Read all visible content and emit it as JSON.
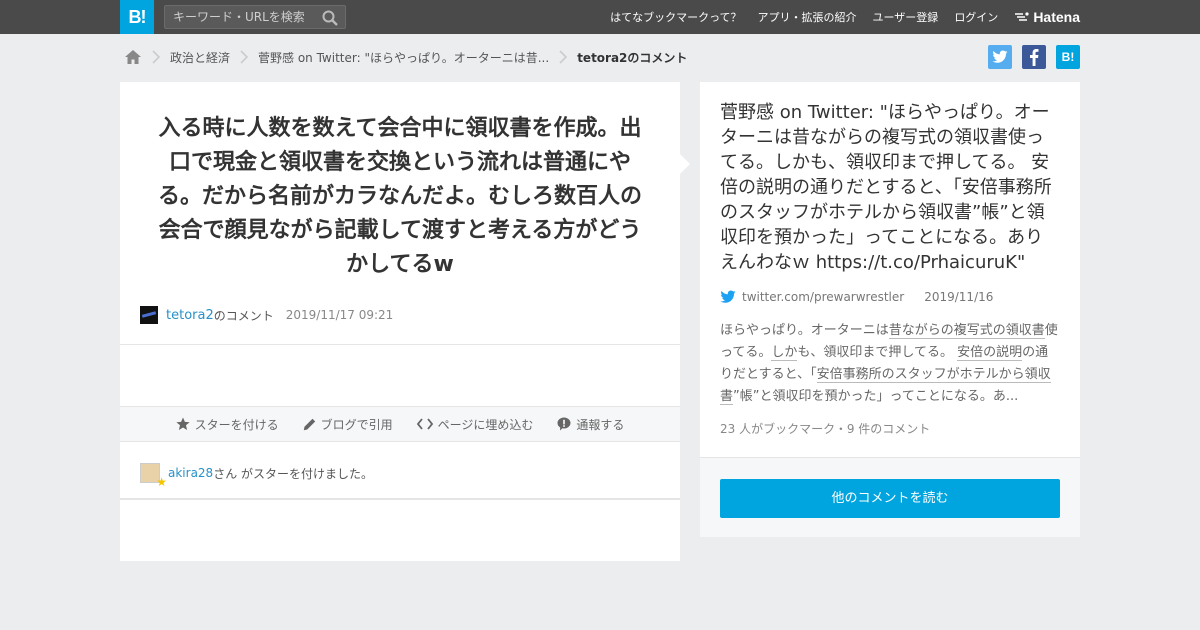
{
  "header": {
    "logo": "B!",
    "search_placeholder": "キーワード・URLを検索",
    "nav": [
      "はてなブックマークって？",
      "アプリ・拡張の紹介",
      "ユーザー登録",
      "ログイン"
    ],
    "brand": "Hatena"
  },
  "breadcrumb": {
    "items": [
      "政治と経済",
      "菅野感 on Twitter: \"ほらやっぱり。オーターニは昔...",
      "tetora2のコメント"
    ]
  },
  "share": {
    "hatena_label": "B!"
  },
  "comment": {
    "text": "入る時に人数を数えて会合中に領収書を作成。出口で現金と領収書を交換という流れは普通にやる。だから名前がカラなんだよ。むしろ数百人の会合で顔見ながら記載して渡すと考える方がどうかしてるw",
    "user": "tetora2",
    "user_suffix": "のコメント",
    "date": "2019/11/17 09:21"
  },
  "actions": {
    "star": "スターを付ける",
    "blog": "ブログで引用",
    "embed": "ページに埋め込む",
    "report": "通報する"
  },
  "stars": {
    "user": "akira28",
    "text": "さん がスターを付けました。"
  },
  "entry": {
    "title": "菅野感 on Twitter: \"ほらやっぱり。オーターニは昔ながらの複写式の領収書使ってる。しかも、領収印まで押してる。 安倍の説明の通りだとすると、「安倍事務所のスタッフがホテルから領収書”帳”と領収印を預かった」ってことになる。ありえんわなｗ https://t.co/PrhaicuruK\"",
    "source": "twitter.com/prewarwrestler",
    "date": "2019/11/16",
    "summary_parts": [
      "ほらやっぱり。オーターニは",
      "昔ながらの複写式の領収書",
      "使ってる。",
      "しか",
      "も、領収印まで押してる。 ",
      "安倍の説明",
      "の通りだとすると、「",
      "安倍事務所のスタッフがホテルから領収書",
      "”帳”と領収印を預かった」ってことになる。あ..."
    ],
    "counts": "23 人がブックマーク・9 件のコメント",
    "read_more": "他のコメントを読む"
  },
  "colors": {
    "brand": "#00a4de",
    "topbar": "#4a4a4a",
    "link": "#2891c8",
    "twitter": "#55acee",
    "facebook": "#3b5998"
  }
}
